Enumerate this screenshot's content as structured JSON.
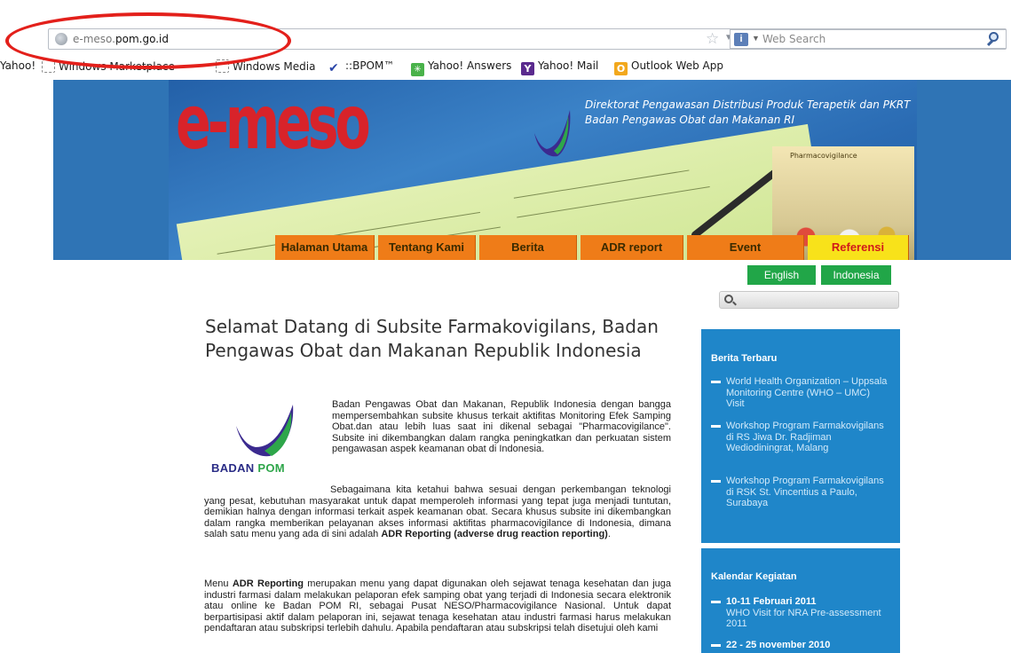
{
  "browser": {
    "url_prefix": "e-meso.",
    "url_host": "pom.go.id",
    "search_placeholder": "Web Search",
    "bookmarks": [
      {
        "label": "Yahoo!",
        "icon": "yahoo-icon"
      },
      {
        "label": "Windows Marketplace",
        "icon": "page-icon"
      },
      {
        "label": "Windows Media",
        "icon": "page-icon"
      },
      {
        "label": "::BPOM™",
        "icon": "bpom-check-icon"
      },
      {
        "label": "Yahoo! Answers",
        "icon": "yahoo-answers-icon"
      },
      {
        "label": "Yahoo! Mail",
        "icon": "yahoo-mail-icon"
      },
      {
        "label": "Outlook Web App",
        "icon": "outlook-icon"
      }
    ]
  },
  "banner": {
    "logo_text": "e-meso",
    "org_line1": "Direktorat Pengawasan Distribusi Produk Terapetik dan PKRT",
    "org_line2": "Badan Pengawas Obat dan Makanan RI",
    "image_caption": "Pharmacovigilance"
  },
  "nav": [
    {
      "label": "Halaman Utama",
      "active": false
    },
    {
      "label": "Tentang Kami",
      "active": false
    },
    {
      "label": "Berita",
      "active": false
    },
    {
      "label": "ADR report",
      "active": false
    },
    {
      "label": "Event",
      "active": false
    },
    {
      "label": "Referensi",
      "active": true
    }
  ],
  "language": {
    "english": "English",
    "indonesia": "Indonesia"
  },
  "main": {
    "title": "Selamat Datang di Subsite Farmakovigilans, Badan Pengawas Obat dan Makanan Republik Indonesia",
    "logo_text_1": "BADAN",
    "logo_text_2": "POM",
    "p1": "Badan Pengawas Obat dan Makanan, Republik Indonesia dengan bangga mempersembahkan subsite khusus terkait aktifitas Monitoring Efek Samping Obat.dan atau lebih luas saat ini dikenal sebagai \"Pharmacovigilance\". Subsite ini dikembangkan dalam rangka peningkatkan dan perkuatan sistem pengawasan aspek keamanan obat di Indonesia.",
    "p2_a": "Sebagaimana kita ketahui bahwa sesuai dengan perkembangan teknologi yang pesat, kebutuhan masyarakat untuk dapat memperoleh informasi yang tepat juga menjadi tuntutan, demikian halnya dengan informasi terkait aspek keamanan obat. Secara khusus subsite ini dikembangkan dalam rangka memberikan pelayanan akses informasi aktifitas pharmacovigilance di Indonesia, dimana salah satu menu yang ada di sini adalah ",
    "p2_b": "ADR Reporting (adverse drug reaction reporting)",
    "p2_c": ".",
    "p3_a": "Menu ",
    "p3_b": "ADR Reporting",
    "p3_c": " merupakan menu yang dapat digunakan oleh sejawat tenaga kesehatan dan juga industri farmasi dalam melakukan pelaporan efek samping obat yang terjadi di Indonesia secara elektronik atau online ke Badan POM RI, sebagai Pusat NESO/Pharmacovigilance Nasional. Untuk dapat berpartisipasi aktif dalam pelaporan ini, sejawat tenaga kesehatan atau industri farmasi harus melakukan pendaftaran atau subskripsi terlebih dahulu. Apabila pendaftaran atau subskripsi telah disetujui oleh kami"
  },
  "sidebar": {
    "news_title": "Berita Terbaru",
    "news": [
      "World Health Organization – Uppsala Monitoring Centre (WHO – UMC) Visit",
      "Workshop Program Farmakovigilans di RS Jiwa Dr. Radjiman Wediodiningrat, Malang",
      "Workshop Program Farmakovigilans di RSK St. Vincentius a Paulo, Surabaya"
    ],
    "events_title": "Kalendar Kegiatan",
    "events": [
      {
        "date": "10-11 Februari 2011",
        "desc": "WHO Visit for NRA Pre-assessment 2011"
      },
      {
        "date": "22 - 25 november 2010",
        "desc": ""
      }
    ]
  },
  "colors": {
    "highlight_circle": "#e3201b",
    "nav_orange": "#ef7c18",
    "nav_active": "#f8e21a",
    "lang_green": "#21a648",
    "sidebar_blue": "#1f86c9"
  }
}
